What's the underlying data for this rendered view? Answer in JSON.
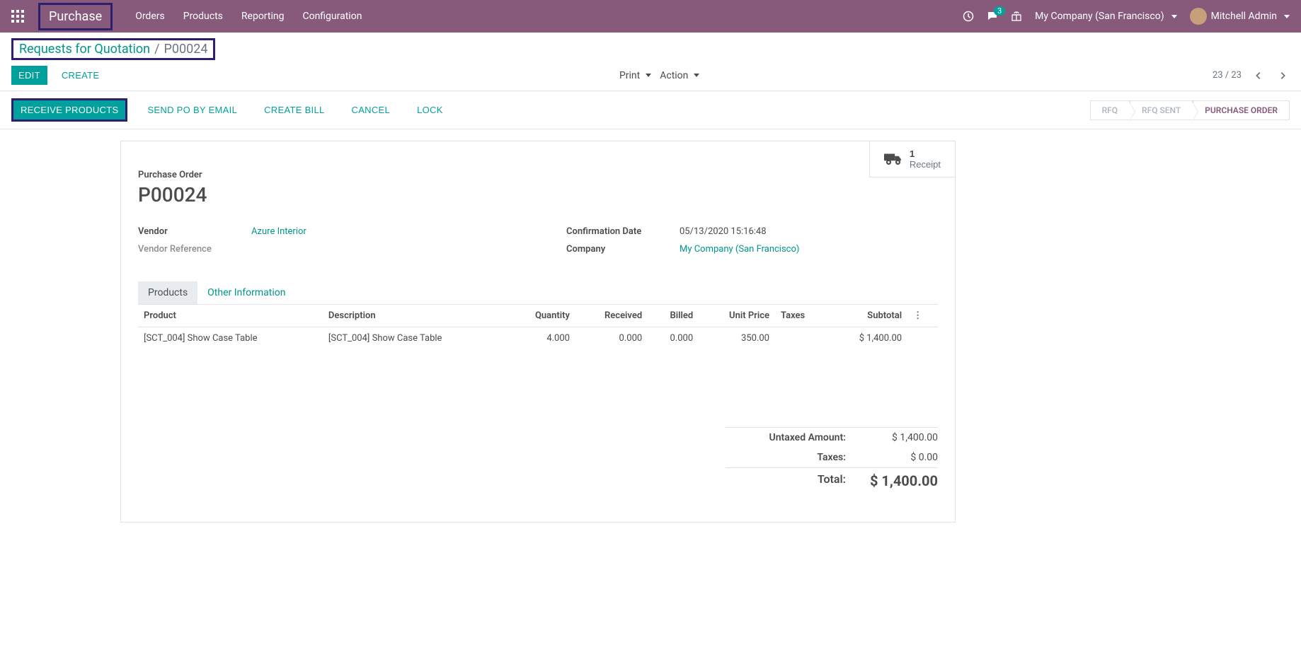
{
  "navbar": {
    "brand": "Purchase",
    "menu": [
      "Orders",
      "Products",
      "Reporting",
      "Configuration"
    ],
    "company": "My Company (San Francisco)",
    "user": "Mitchell Admin",
    "chat_count": "3"
  },
  "breadcrumb": {
    "parent": "Requests for Quotation",
    "sep": "/",
    "current": "P00024"
  },
  "cp": {
    "edit": "Edit",
    "create": "Create",
    "print": "Print",
    "action": "Action",
    "pager": "23 / 23"
  },
  "statusbar": {
    "receive": "Receive Products",
    "send_po": "Send PO by Email",
    "create_bill": "Create Bill",
    "cancel": "Cancel",
    "lock": "Lock",
    "steps": {
      "rfq": "RFQ",
      "rfq_sent": "RFQ Sent",
      "po": "Purchase Order"
    }
  },
  "stat": {
    "count": "1",
    "label": "Receipt"
  },
  "form": {
    "title_label": "Purchase Order",
    "title": "P00024",
    "vendor_label": "Vendor",
    "vendor": "Azure Interior",
    "vendor_ref_label": "Vendor Reference",
    "conf_date_label": "Confirmation Date",
    "conf_date": "05/13/2020 15:16:48",
    "company_label": "Company",
    "company": "My Company (San Francisco)"
  },
  "tabs": {
    "products": "Products",
    "other": "Other Information"
  },
  "table": {
    "headers": {
      "product": "Product",
      "description": "Description",
      "quantity": "Quantity",
      "received": "Received",
      "billed": "Billed",
      "unitprice": "Unit Price",
      "taxes": "Taxes",
      "subtotal": "Subtotal"
    },
    "row": {
      "product": "[SCT_004] Show Case Table",
      "description": "[SCT_004] Show Case Table",
      "quantity": "4.000",
      "received": "0.000",
      "billed": "0.000",
      "unitprice": "350.00",
      "taxes": "",
      "subtotal": "$ 1,400.00"
    }
  },
  "totals": {
    "untaxed_label": "Untaxed Amount:",
    "untaxed": "$ 1,400.00",
    "taxes_label": "Taxes:",
    "taxes": "$ 0.00",
    "total_label": "Total:",
    "total": "$ 1,400.00"
  }
}
